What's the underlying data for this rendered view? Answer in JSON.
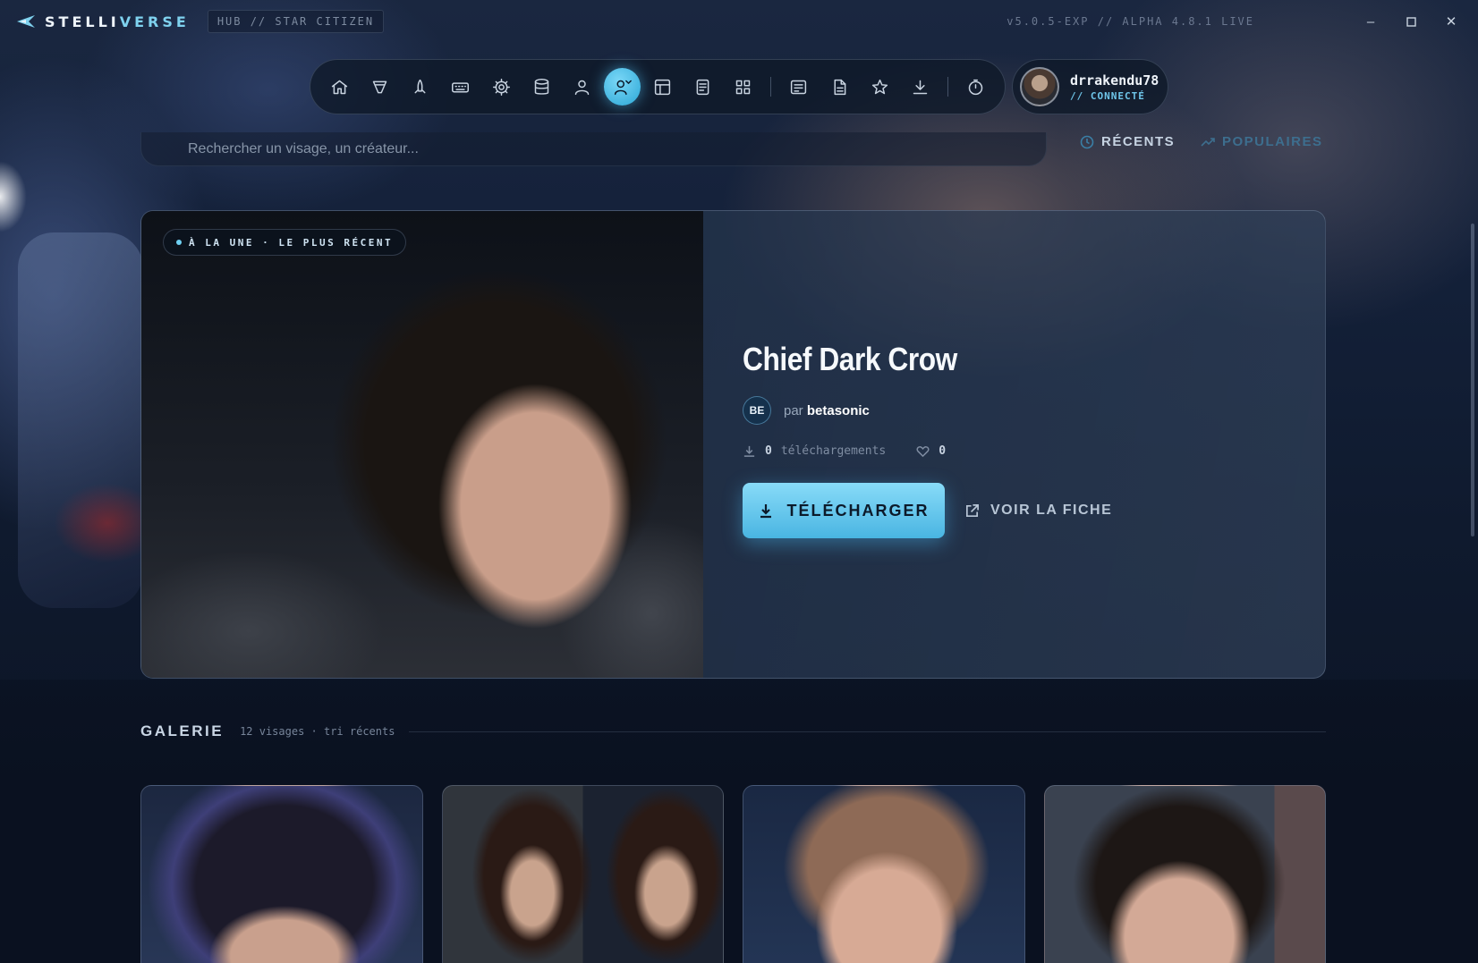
{
  "app": {
    "logo_main": "STELLI",
    "logo_accent": "VERSE",
    "hub_label": "HUB // STAR CITIZEN",
    "version": "v5.0.5-EXP // ALPHA 4.8.1 LIVE",
    "window_controls": [
      "minimize-icon",
      "maximize-icon",
      "close-icon"
    ]
  },
  "nav": {
    "items": [
      {
        "icon": "home-icon"
      },
      {
        "icon": "ship-icon"
      },
      {
        "icon": "rocket-icon"
      },
      {
        "icon": "keyboard-icon"
      },
      {
        "icon": "settings-icon"
      },
      {
        "icon": "database-icon"
      },
      {
        "icon": "user-icon"
      },
      {
        "icon": "face-user-icon",
        "active": true
      },
      {
        "icon": "layout-icon"
      },
      {
        "icon": "notes-icon"
      },
      {
        "icon": "grid-icon"
      },
      {
        "icon": "news-icon"
      },
      {
        "icon": "document-icon"
      },
      {
        "icon": "star-icon"
      },
      {
        "icon": "download-icon"
      },
      {
        "icon": "timer-icon"
      }
    ]
  },
  "user": {
    "name": "drrakendu78",
    "status": "// CONNECTÉ"
  },
  "search": {
    "placeholder": "Rechercher un visage, un créateur..."
  },
  "sort": {
    "recent": "RÉCENTS",
    "popular": "POPULAIRES"
  },
  "hero": {
    "badge": "À LA UNE · LE PLUS RÉCENT",
    "title": "Chief Dark Crow",
    "author_initials": "BE",
    "author_prefix": "par",
    "author_name": "betasonic",
    "downloads": "0",
    "downloads_label": "téléchargements",
    "likes": "0",
    "download_button": "TÉLÉCHARGER",
    "view_button": "VOIR LA FICHE"
  },
  "gallery": {
    "title": "GALERIE",
    "subtitle": "12 visages · tri récents"
  },
  "colors": {
    "accent": "#6fd0f2",
    "background": "#0b1322"
  }
}
